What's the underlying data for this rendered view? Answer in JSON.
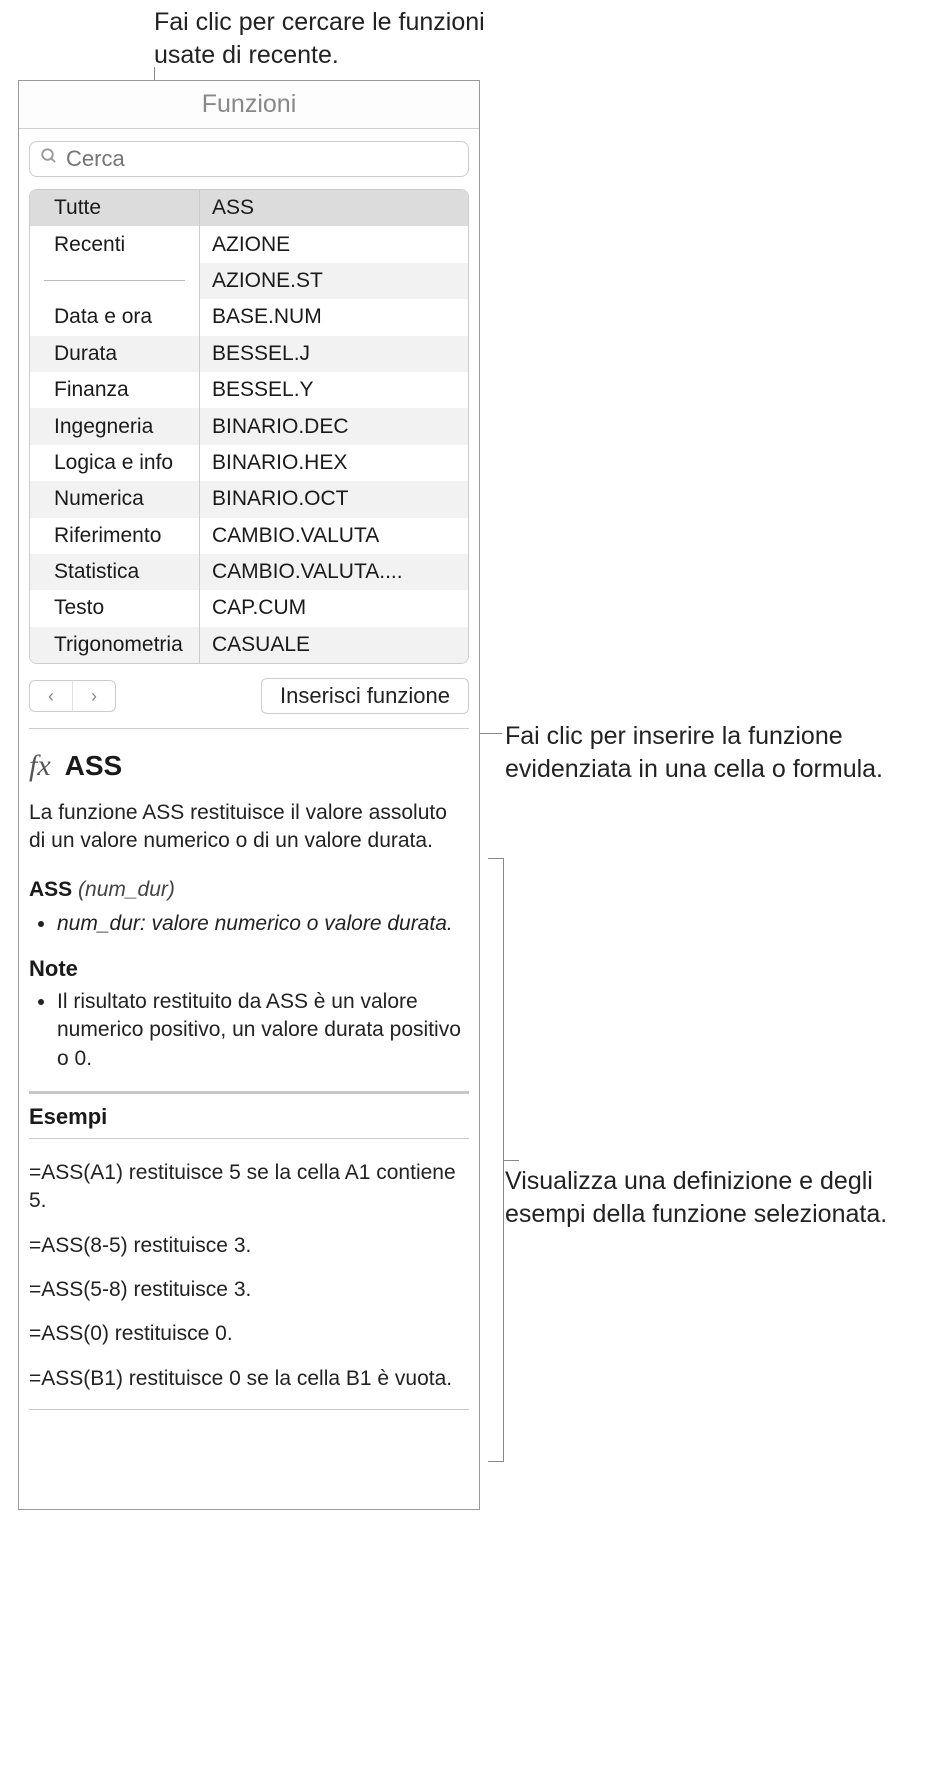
{
  "callouts": {
    "top": "Fai clic per cercare le funzioni usate di recente.",
    "insert": "Fai clic per inserire la funzione evidenziata in una cella o formula.",
    "description": "Visualizza una definizione e degli esempi della funzione selezionata."
  },
  "panel": {
    "title": "Funzioni",
    "search_placeholder": "Cerca",
    "insert_button": "Inserisci funzione",
    "nav_prev_glyph": "‹",
    "nav_next_glyph": "›"
  },
  "categories": [
    "Tutte",
    "Recenti",
    "",
    "Data e ora",
    "Durata",
    "Finanza",
    "Ingegneria",
    "Logica e info",
    "Numerica",
    "Riferimento",
    "Statistica",
    "Testo",
    "Trigonometria"
  ],
  "functions": [
    "ASS",
    "AZIONE",
    "AZIONE.ST",
    "BASE.NUM",
    "BESSEL.J",
    "BESSEL.Y",
    "BINARIO.DEC",
    "BINARIO.HEX",
    "BINARIO.OCT",
    "CAMBIO.VALUTA",
    "CAMBIO.VALUTA....",
    "CAP.CUM",
    "CASUALE"
  ],
  "definition": {
    "fx_label": "fx",
    "name": "ASS",
    "summary": "La funzione ASS restituisce il valore assoluto di un valore numerico o di un valore durata.",
    "signature_name": "ASS",
    "signature_args": "(num_dur)",
    "param_desc": "num_dur: valore numerico o valore durata.",
    "note_heading": "Note",
    "note_text": "Il risultato restituito da ASS è un valore numerico positivo, un valore durata positivo o 0.",
    "examples_heading": "Esempi",
    "examples": [
      "=ASS(A1) restituisce 5 se la cella A1 contiene 5.",
      "=ASS(8-5) restituisce 3.",
      "=ASS(5-8) restituisce 3.",
      "=ASS(0) restituisce 0.",
      "=ASS(B1) restituisce 0 se la cella B1 è vuota."
    ]
  }
}
